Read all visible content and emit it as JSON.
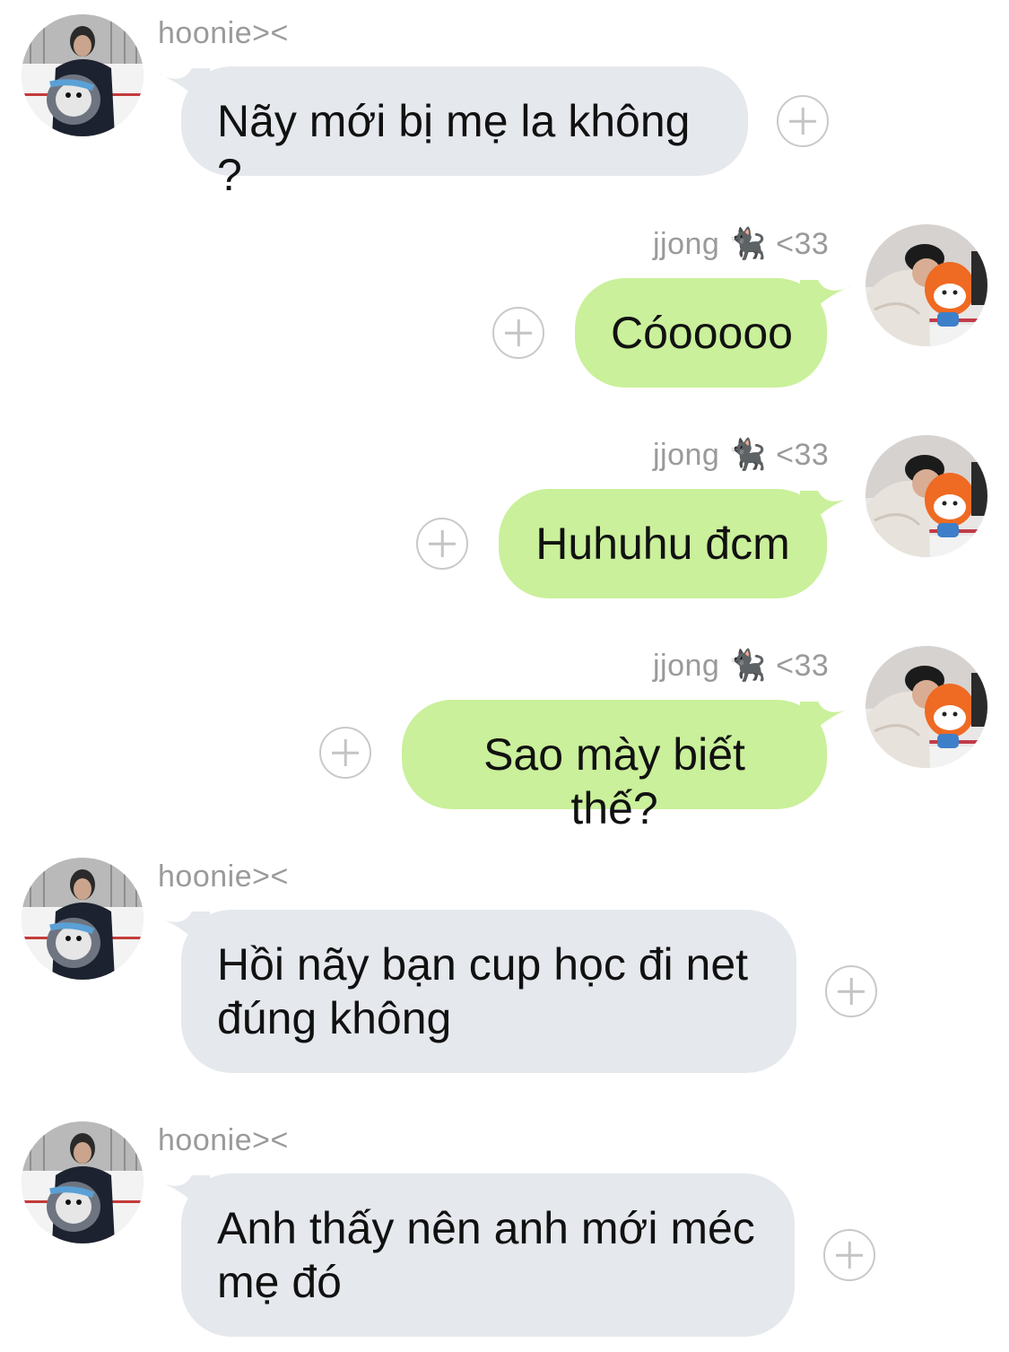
{
  "colors": {
    "incoming_bubble": "#e5e8ed",
    "outgoing_bubble": "#caf09b",
    "sender_text": "#9a9a9a",
    "react_icon": "#c9c9c9"
  },
  "messages": [
    {
      "direction": "incoming",
      "sender": "hoonie><",
      "text": "Nãy mới bị mẹ la không ?",
      "avatar": "penguin-plush-avatar"
    },
    {
      "direction": "outgoing",
      "sender_name": "jjong",
      "sender_emoji": "🐈‍⬛",
      "sender_suffix": "<33",
      "text": "Cóooooo",
      "avatar": "orange-plush-avatar"
    },
    {
      "direction": "outgoing",
      "sender_name": "jjong",
      "sender_emoji": "🐈‍⬛",
      "sender_suffix": "<33",
      "text": "Huhuhu đcm",
      "avatar": "orange-plush-avatar"
    },
    {
      "direction": "outgoing",
      "sender_name": "jjong",
      "sender_emoji": "🐈‍⬛",
      "sender_suffix": "<33",
      "text": "Sao mày biết thế?",
      "avatar": "orange-plush-avatar"
    },
    {
      "direction": "incoming",
      "sender": "hoonie><",
      "text": "Hồi nãy bạn cup học đi net đúng không",
      "avatar": "penguin-plush-avatar"
    },
    {
      "direction": "incoming",
      "sender": "hoonie><",
      "text": "Anh thấy nên anh mới méc mẹ đó",
      "avatar": "penguin-plush-avatar"
    }
  ]
}
